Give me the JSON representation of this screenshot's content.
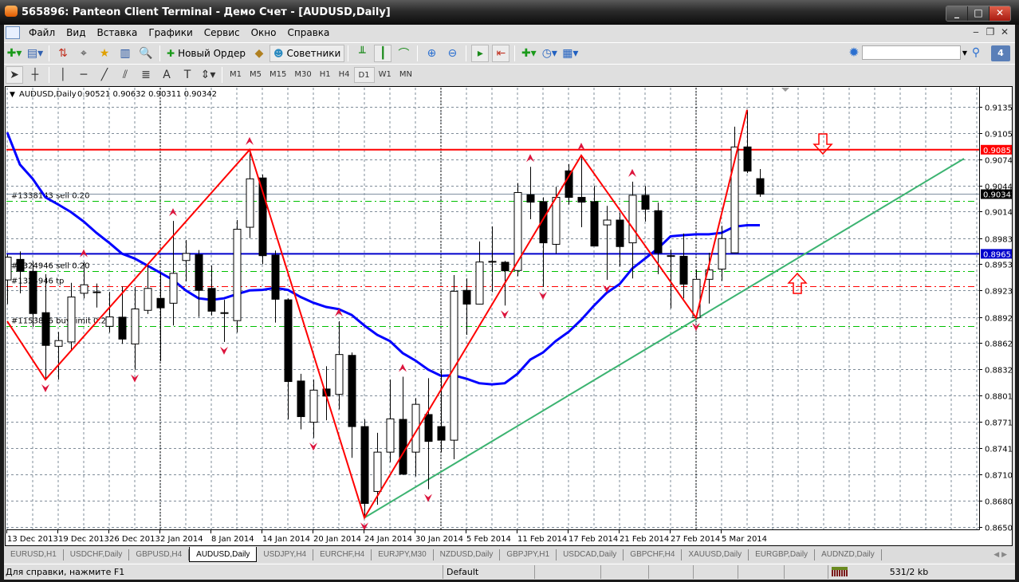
{
  "window": {
    "title": "565896: Panteon Client Terminal - Демо Счет - [AUDUSD,Daily]",
    "buttons": [
      "minimize",
      "maximize",
      "close"
    ]
  },
  "menu": [
    "Файл",
    "Вид",
    "Вставка",
    "Графики",
    "Сервис",
    "Окно",
    "Справка"
  ],
  "toolbar": {
    "new_order": "Новый Ордер",
    "experts": "Советники",
    "search_value": "",
    "notifications": "4"
  },
  "timeframes": [
    "M1",
    "M5",
    "M15",
    "M30",
    "H1",
    "H4",
    "D1",
    "W1",
    "MN"
  ],
  "active_timeframe": "D1",
  "chart": {
    "symbol": "AUDUSD,Daily",
    "ohlc": "0.90521 0.90632 0.90311 0.90342",
    "order_labels": [
      {
        "text": "#1338143 sell 0.20",
        "price": 0.90264,
        "color": "#00c000"
      },
      {
        "text": "#1324946 sell 0.20",
        "price": 0.89454,
        "color": "#00c000"
      },
      {
        "text": "#1324946 tp",
        "price": 0.89279,
        "color": "#ff0000"
      },
      {
        "text": "#1153866 buy limit 0.20",
        "price": 0.88819,
        "color": "#00c000"
      }
    ],
    "price_tags": [
      {
        "text": "0.90855",
        "price": 0.90855,
        "bg": "#ff0000"
      },
      {
        "text": "0.90342",
        "price": 0.90342,
        "bg": "#000000"
      },
      {
        "text": "0.89653",
        "price": 0.89653,
        "bg": "#0000cc"
      }
    ]
  },
  "chart_data": {
    "type": "candlestick",
    "title": "AUDUSD,Daily",
    "ylim": [
      0.865,
      0.9135
    ],
    "price_ticks": [
      "0.91350",
      "0.91050",
      "0.90745",
      "0.90440",
      "0.90140",
      "0.89835",
      "0.89535",
      "0.89230",
      "0.88925",
      "0.88625",
      "0.88320",
      "0.88015",
      "0.87715",
      "0.87410",
      "0.87105",
      "0.86805",
      "0.86500"
    ],
    "date_labels": [
      {
        "bar": 0,
        "text": "13 Dec 2013"
      },
      {
        "bar": 4,
        "text": "19 Dec 2013"
      },
      {
        "bar": 8,
        "text": "26 Dec 2013"
      },
      {
        "bar": 12,
        "text": "2 Jan 2014"
      },
      {
        "bar": 16,
        "text": "8 Jan 2014"
      },
      {
        "bar": 20,
        "text": "14 Jan 2014"
      },
      {
        "bar": 24,
        "text": "20 Jan 2014"
      },
      {
        "bar": 28,
        "text": "24 Jan 2014"
      },
      {
        "bar": 32,
        "text": "30 Jan 2014"
      },
      {
        "bar": 36,
        "text": "5 Feb 2014"
      },
      {
        "bar": 40,
        "text": "11 Feb 2014"
      },
      {
        "bar": 44,
        "text": "17 Feb 2014"
      },
      {
        "bar": 48,
        "text": "21 Feb 2014"
      },
      {
        "bar": 52,
        "text": "27 Feb 2014"
      },
      {
        "bar": 56,
        "text": "5 Mar 2014"
      }
    ],
    "candles_ohlc": [
      [
        0.89352,
        0.89648,
        0.89073,
        0.89615
      ],
      [
        0.89589,
        0.89681,
        0.89198,
        0.89451
      ],
      [
        0.89451,
        0.89566,
        0.8881,
        0.88964
      ],
      [
        0.88974,
        0.89418,
        0.88202,
        0.88596
      ],
      [
        0.88586,
        0.88751,
        0.88202,
        0.88652
      ],
      [
        0.88636,
        0.89319,
        0.88547,
        0.89155
      ],
      [
        0.89198,
        0.89559,
        0.89139,
        0.89296
      ],
      [
        0.89214,
        0.8931,
        0.89033,
        0.8921
      ],
      [
        0.88816,
        0.89214,
        0.88744,
        0.88925
      ],
      [
        0.88922,
        0.89277,
        0.88613,
        0.88669
      ],
      [
        0.88613,
        0.8927,
        0.88317,
        0.89017
      ],
      [
        0.89001,
        0.89533,
        0.88958,
        0.89254
      ],
      [
        0.89139,
        0.89435,
        0.88415,
        0.8903
      ],
      [
        0.89083,
        0.90033,
        0.88826,
        0.89428
      ],
      [
        0.89576,
        0.89812,
        0.89336,
        0.89658
      ],
      [
        0.89642,
        0.89697,
        0.88925,
        0.89231
      ],
      [
        0.89254,
        0.89517,
        0.88941,
        0.88991
      ],
      [
        0.88974,
        0.89122,
        0.88636,
        0.8897
      ],
      [
        0.88882,
        0.90043,
        0.88744,
        0.89937
      ],
      [
        0.8996,
        0.90854,
        0.89835,
        0.90519
      ],
      [
        0.90529,
        0.90568,
        0.89533,
        0.89632
      ],
      [
        0.89638,
        0.89691,
        0.88859,
        0.89129
      ],
      [
        0.89122,
        0.89139,
        0.87742,
        0.88179
      ],
      [
        0.88185,
        0.88268,
        0.87627,
        0.87774
      ],
      [
        0.87709,
        0.88202,
        0.87528,
        0.8808
      ],
      [
        0.88093,
        0.88356,
        0.87732,
        0.88011
      ],
      [
        0.88031,
        0.88876,
        0.87857,
        0.88491
      ],
      [
        0.88481,
        0.88514,
        0.87298,
        0.87659
      ],
      [
        0.87659,
        0.87742,
        0.86607,
        0.86772
      ],
      [
        0.8691,
        0.87587,
        0.86756,
        0.87364
      ],
      [
        0.87364,
        0.88202,
        0.87249,
        0.87748
      ],
      [
        0.87742,
        0.88235,
        0.871,
        0.8711
      ],
      [
        0.87364,
        0.87988,
        0.87084,
        0.87916
      ],
      [
        0.87798,
        0.88218,
        0.86936,
        0.87488
      ],
      [
        0.87659,
        0.88317,
        0.87364,
        0.87502
      ],
      [
        0.87502,
        0.89408,
        0.87282,
        0.89221
      ],
      [
        0.89231,
        0.89369,
        0.88718,
        0.89073
      ],
      [
        0.89073,
        0.89796,
        0.8907,
        0.89559
      ],
      [
        0.89566,
        0.8997,
        0.89211,
        0.8956
      ],
      [
        0.89556,
        0.89572,
        0.89056,
        0.89457
      ],
      [
        0.89461,
        0.9047,
        0.89395,
        0.90361
      ],
      [
        0.90335,
        0.90657,
        0.90052,
        0.9025
      ],
      [
        0.90256,
        0.90305,
        0.8927,
        0.8978
      ],
      [
        0.89763,
        0.90427,
        0.89655,
        0.90305
      ],
      [
        0.90611,
        0.9069,
        0.90223,
        0.90305
      ],
      [
        0.90305,
        0.90789,
        0.8996,
        0.9025
      ],
      [
        0.90256,
        0.90437,
        0.8974,
        0.89743
      ],
      [
        0.89987,
        0.90207,
        0.89352,
        0.90043
      ],
      [
        0.90043,
        0.90125,
        0.89507,
        0.89737
      ],
      [
        0.8978,
        0.90486,
        0.89369,
        0.90329
      ],
      [
        0.90329,
        0.90437,
        0.90026,
        0.90168
      ],
      [
        0.90151,
        0.90246,
        0.89418,
        0.89665
      ],
      [
        0.89632,
        0.89704,
        0.89024,
        0.89625
      ],
      [
        0.89625,
        0.89888,
        0.89139,
        0.89303
      ],
      [
        0.88915,
        0.89474,
        0.8891,
        0.89359
      ],
      [
        0.89359,
        0.89665,
        0.89079,
        0.89467
      ],
      [
        0.89477,
        0.89977,
        0.89342,
        0.89829
      ],
      [
        0.89665,
        0.91121,
        0.8966,
        0.90887
      ],
      [
        0.90887,
        0.91315,
        0.90585,
        0.90608
      ],
      [
        0.90521,
        0.90632,
        0.90311,
        0.90342
      ]
    ],
    "moving_average": [
      0.91055,
      0.90684,
      0.90519,
      0.90305,
      0.90223,
      0.90135,
      0.90026,
      0.89895,
      0.8978,
      0.89655,
      0.89599,
      0.89517,
      0.89435,
      0.89352,
      0.89231,
      0.89139,
      0.89122,
      0.89139,
      0.89188,
      0.89231,
      0.89237,
      0.8926,
      0.89237,
      0.89155,
      0.89089,
      0.8904,
      0.89014,
      0.88948,
      0.88826,
      0.88718,
      0.88646,
      0.88507,
      0.88422,
      0.88317,
      0.88245,
      0.88251,
      0.88212,
      0.88159,
      0.88146,
      0.88159,
      0.88268,
      0.88432,
      0.88514,
      0.88646,
      0.88751,
      0.88892,
      0.89056,
      0.89204,
      0.89303,
      0.89484,
      0.89599,
      0.89714,
      0.89855,
      0.89868,
      0.89878,
      0.89878,
      0.89895,
      0.89967,
      0.89983,
      0.89983
    ],
    "zigzag": [
      [
        0,
        0.88876
      ],
      [
        3,
        0.88202
      ],
      [
        19,
        0.90854
      ],
      [
        28,
        0.86607
      ],
      [
        45,
        0.90789
      ],
      [
        54,
        0.88915
      ],
      [
        58,
        0.91315
      ]
    ],
    "fractals_up": [
      6,
      13,
      19,
      26,
      31,
      41,
      45,
      49
    ],
    "fractals_down": [
      3,
      10,
      17,
      24,
      28,
      33,
      39,
      42,
      47,
      54
    ],
    "month_separators": [
      12,
      34,
      54
    ],
    "hlines": [
      {
        "price": 0.90855,
        "color": "#ff0000"
      },
      {
        "price": 0.89653,
        "color": "#0000cc"
      },
      {
        "price": 0.90342,
        "color": "#8090a0"
      }
    ],
    "trendline": {
      "from": [
        28,
        0.86607
      ],
      "to": [
        75,
        0.90752
      ],
      "color": "#3cb371"
    }
  },
  "tabs": [
    "EURUSD,H1",
    "USDCHF,Daily",
    "GBPUSD,H4",
    "AUDUSD,Daily",
    "USDJPY,H4",
    "EURCHF,H4",
    "EURJPY,M30",
    "NZDUSD,Daily",
    "GBPJPY,H1",
    "USDCAD,Daily",
    "GBPCHF,H4",
    "XAUUSD,Daily",
    "EURGBP,Daily",
    "AUDNZD,Daily"
  ],
  "active_tab": 3,
  "status": {
    "help": "Для справки, нажмите F1",
    "profile": "Default",
    "traffic": "531/2 kb"
  }
}
